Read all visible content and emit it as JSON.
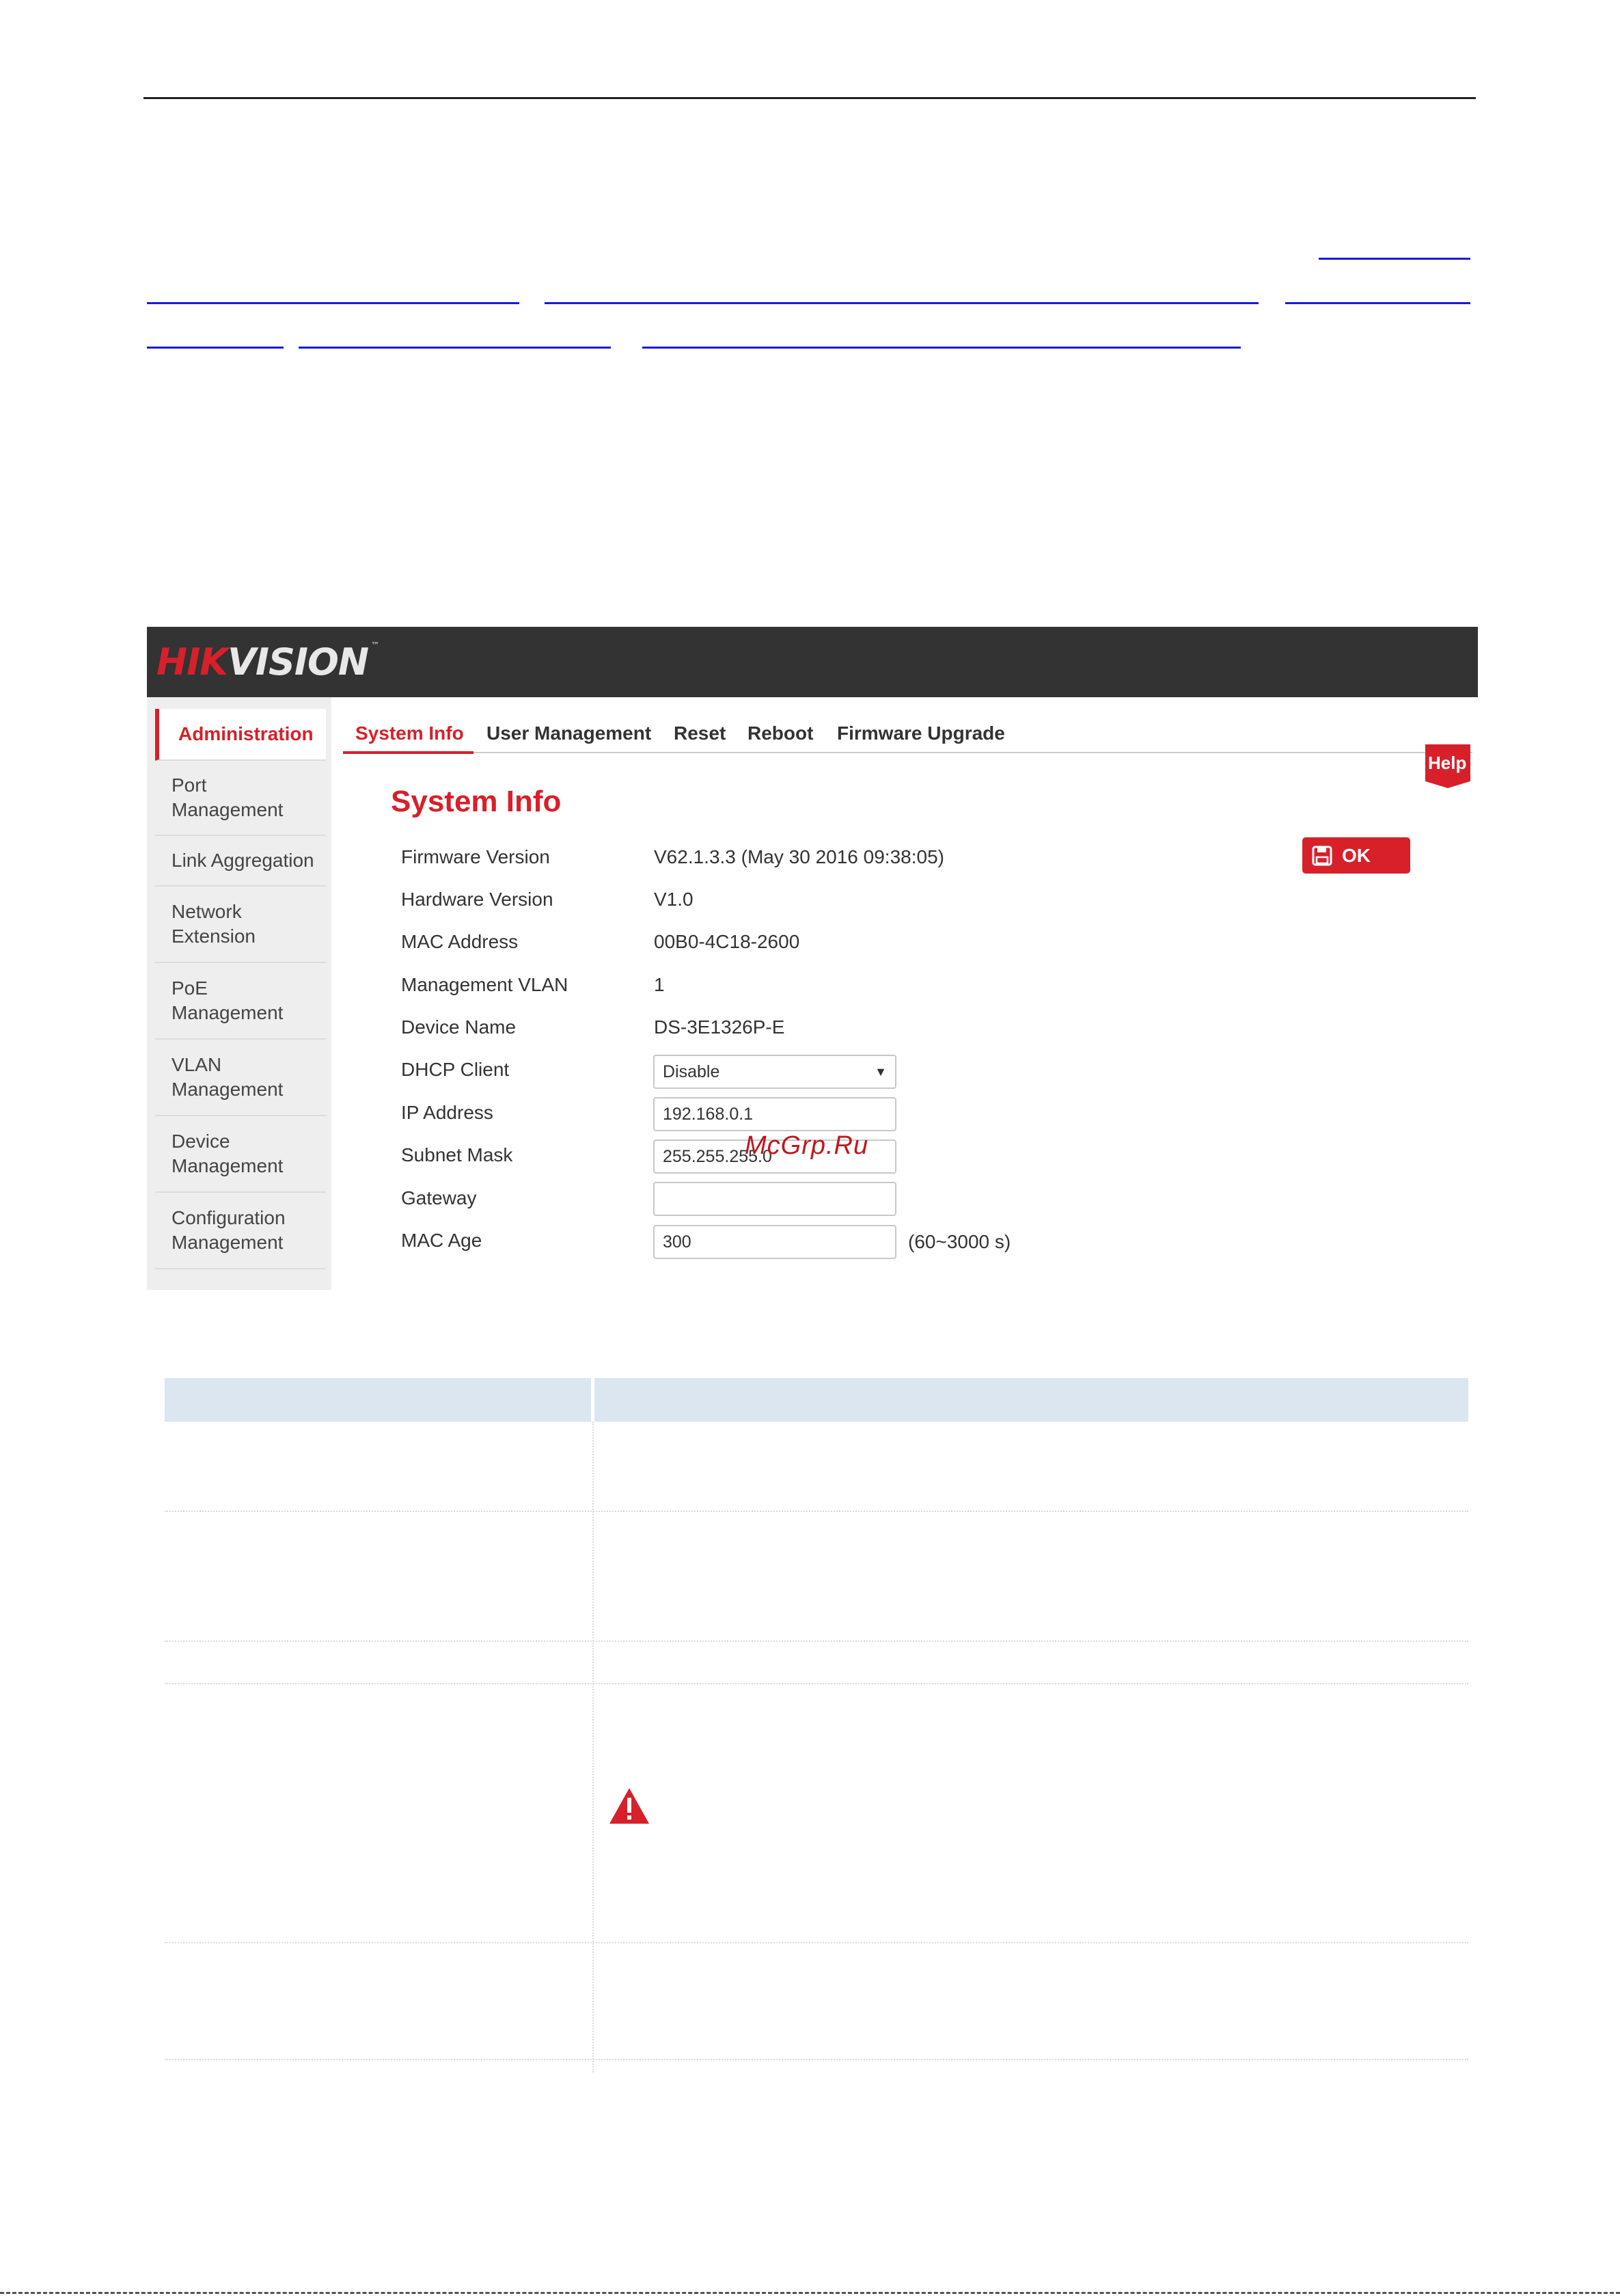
{
  "window": {
    "brand_hik": "HIK",
    "brand_vision": "VISION",
    "brand_tm": "™"
  },
  "sidebar": {
    "items": [
      {
        "label": "Administration",
        "active": true
      },
      {
        "label": "Port\nManagement"
      },
      {
        "label": "Link Aggregation"
      },
      {
        "label": "Network\nExtension"
      },
      {
        "label": "PoE\nManagement"
      },
      {
        "label": "VLAN\nManagement"
      },
      {
        "label": "Device\nManagement"
      },
      {
        "label": "Configuration\nManagement"
      }
    ]
  },
  "tabs": [
    {
      "label": "System Info",
      "active": true
    },
    {
      "label": "User Management"
    },
    {
      "label": "Reset"
    },
    {
      "label": "Reboot"
    },
    {
      "label": "Firmware Upgrade"
    }
  ],
  "help_label": "Help",
  "page_title": "System Info",
  "ok_label": "OK",
  "info": {
    "firmware_label": "Firmware Version",
    "firmware_value": "V62.1.3.3 (May 30 2016 09:38:05)",
    "hardware_label": "Hardware Version",
    "hardware_value": "V1.0",
    "mac_label": "MAC Address",
    "mac_value": "00B0-4C18-2600",
    "vlan_label": "Management VLAN",
    "vlan_value": "1",
    "device_label": "Device Name",
    "device_value": "DS-3E1326P-E",
    "dhcp_label": "DHCP Client",
    "dhcp_value": "Disable",
    "ip_label": "IP Address",
    "ip_value": "192.168.0.1",
    "subnet_label": "Subnet Mask",
    "subnet_value": "255.255.255.0",
    "gateway_label": "Gateway",
    "gateway_value": "",
    "macage_label": "MAC Age",
    "macage_value": "300",
    "macage_range": "(60~3000 s)"
  },
  "watermark": "McGrp.Ru",
  "colors": {
    "accent": "#d7202a",
    "topbar": "#333333",
    "sidebar": "#eeeeee",
    "table_header": "#dce6f1",
    "link": "#1a1adb"
  },
  "icons": {
    "ok": "floppy-disk-icon",
    "help": "help-ribbon-icon",
    "dhcp": "chevron-down-icon",
    "warning": "warning-triangle-icon"
  }
}
